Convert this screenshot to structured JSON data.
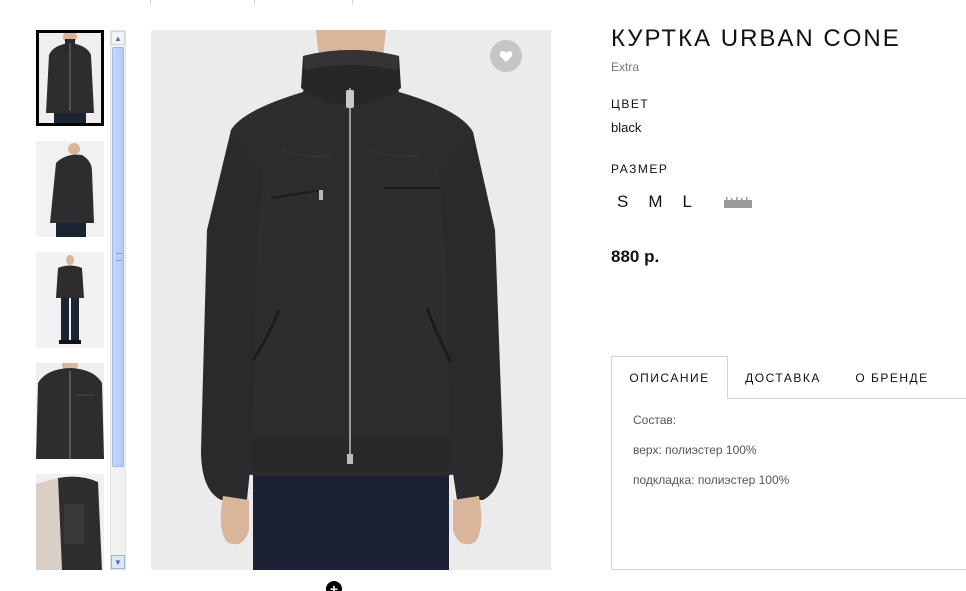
{
  "product": {
    "title": "КУРТКА URBAN CONE",
    "brand": "Extra",
    "color_label": "ЦВЕТ",
    "color_value": "black",
    "size_label": "РАЗМЕР",
    "sizes": [
      "S",
      "M",
      "L"
    ],
    "size_chart_icon": "ruler-icon",
    "price": "880 р."
  },
  "gallery": {
    "thumbnails": [
      {
        "view": "front"
      },
      {
        "view": "side"
      },
      {
        "view": "full-length"
      },
      {
        "view": "detail"
      },
      {
        "view": "inside"
      }
    ],
    "active_index": 0,
    "favorite_icon": "heart-icon",
    "zoom_icon": "plus-icon"
  },
  "tabs": {
    "items": [
      "ОПИСАНИЕ",
      "ДОСТАВКА",
      "О БРЕНДЕ"
    ],
    "active_index": 0,
    "description": {
      "heading": "Состав:",
      "lines": [
        "верх: полиэстер 100%",
        "подкладка: полиэстер 100%"
      ]
    }
  },
  "colors": {
    "jacket": "#2e2c2f",
    "background": "#eaeaea",
    "text": "#111111",
    "muted": "#777777",
    "scrollbar": "#b3c7f6"
  }
}
